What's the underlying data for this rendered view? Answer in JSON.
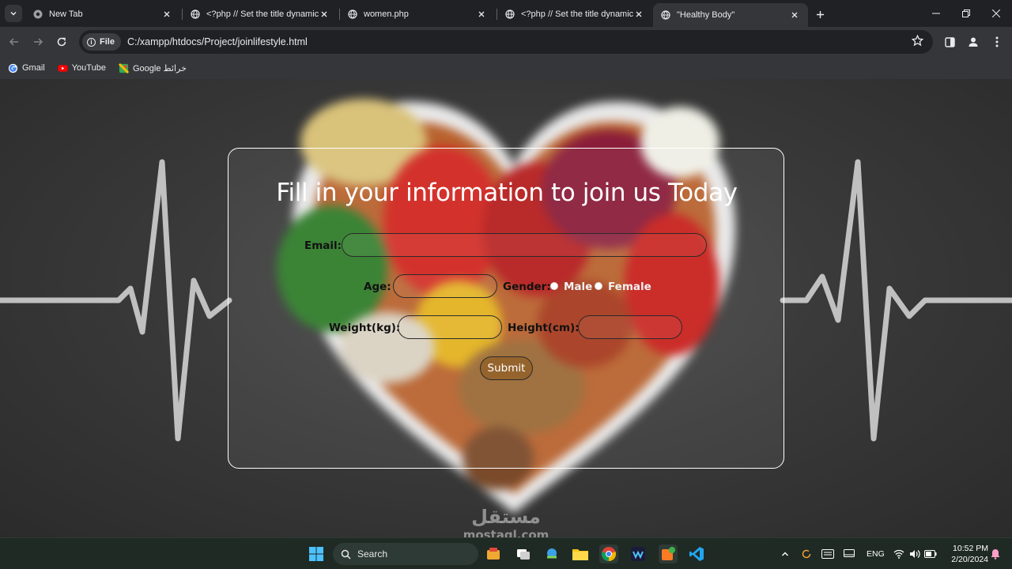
{
  "browser": {
    "tabs": [
      {
        "title": "New Tab",
        "active": false
      },
      {
        "title": "<?php // Set the title dynamica",
        "active": false
      },
      {
        "title": "women.php",
        "active": false
      },
      {
        "title": "<?php // Set the title dynamica",
        "active": false
      },
      {
        "title": "\"Healthy Body\"",
        "active": true
      }
    ],
    "address": {
      "scheme_chip": "File",
      "url": "C:/xampp/htdocs/Project/joinlifestyle.html"
    },
    "bookmarks": [
      {
        "label": "Gmail",
        "icon": "google-icon"
      },
      {
        "label": "YouTube",
        "icon": "youtube-icon"
      },
      {
        "label": "Google خرائط",
        "icon": "maps-icon"
      }
    ]
  },
  "page": {
    "title": "Fill in your information to join us Today",
    "fields": {
      "email_label": "Email:",
      "age_label": "Age:",
      "gender_label": "Gender:",
      "gender_options": [
        "Male",
        "Female"
      ],
      "weight_label": "Weight(kg):",
      "height_label": "Height(cm):"
    },
    "submit_label": "Submit",
    "watermark": "مستقل",
    "watermark_sub": "mostaql.com"
  },
  "taskbar": {
    "search_label": "Search",
    "language": "ENG",
    "time": "10:52 PM",
    "date": "2/20/2024"
  }
}
